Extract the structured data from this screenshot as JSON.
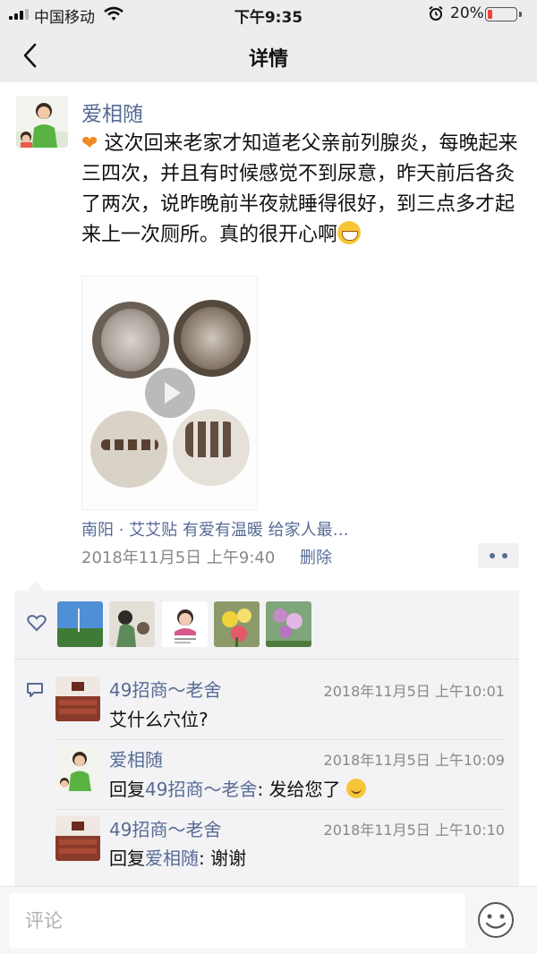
{
  "status_bar": {
    "carrier": "中国移动",
    "time": "下午9:35",
    "battery": "20%"
  },
  "nav": {
    "title": "详情"
  },
  "post": {
    "author": "爱相随",
    "text": "这次回来老家才知道老父亲前列腺炎，每晚起来三四次，并且有时候感觉不到尿意，昨天前后各灸了两次，说昨晚前半夜就睡得很好，到三点多才起来上一次厕所。真的很开心啊",
    "location": "南阳 · 艾艾贴 有爱有温暖 给家人最…",
    "time": "2018年11月5日 上午9:40",
    "delete_label": "删除"
  },
  "comments": [
    {
      "name": "49招商～老舍",
      "time": "2018年11月5日 上午10:01",
      "text": "艾什么穴位?"
    },
    {
      "name": "爱相随",
      "time": "2018年11月5日 上午10:09",
      "reply_prefix": "回复",
      "reply_to": "49招商～老舍",
      "reply_text": ": 发给您了"
    },
    {
      "name": "49招商～老舍",
      "time": "2018年11月5日 上午10:10",
      "reply_prefix": "回复",
      "reply_to": "爱相随",
      "reply_text": ": 谢谢"
    }
  ],
  "input": {
    "placeholder": "评论"
  },
  "colors": {
    "link": "#576b95",
    "panel": "#f3f3f5",
    "nav_bg": "#ededed"
  }
}
